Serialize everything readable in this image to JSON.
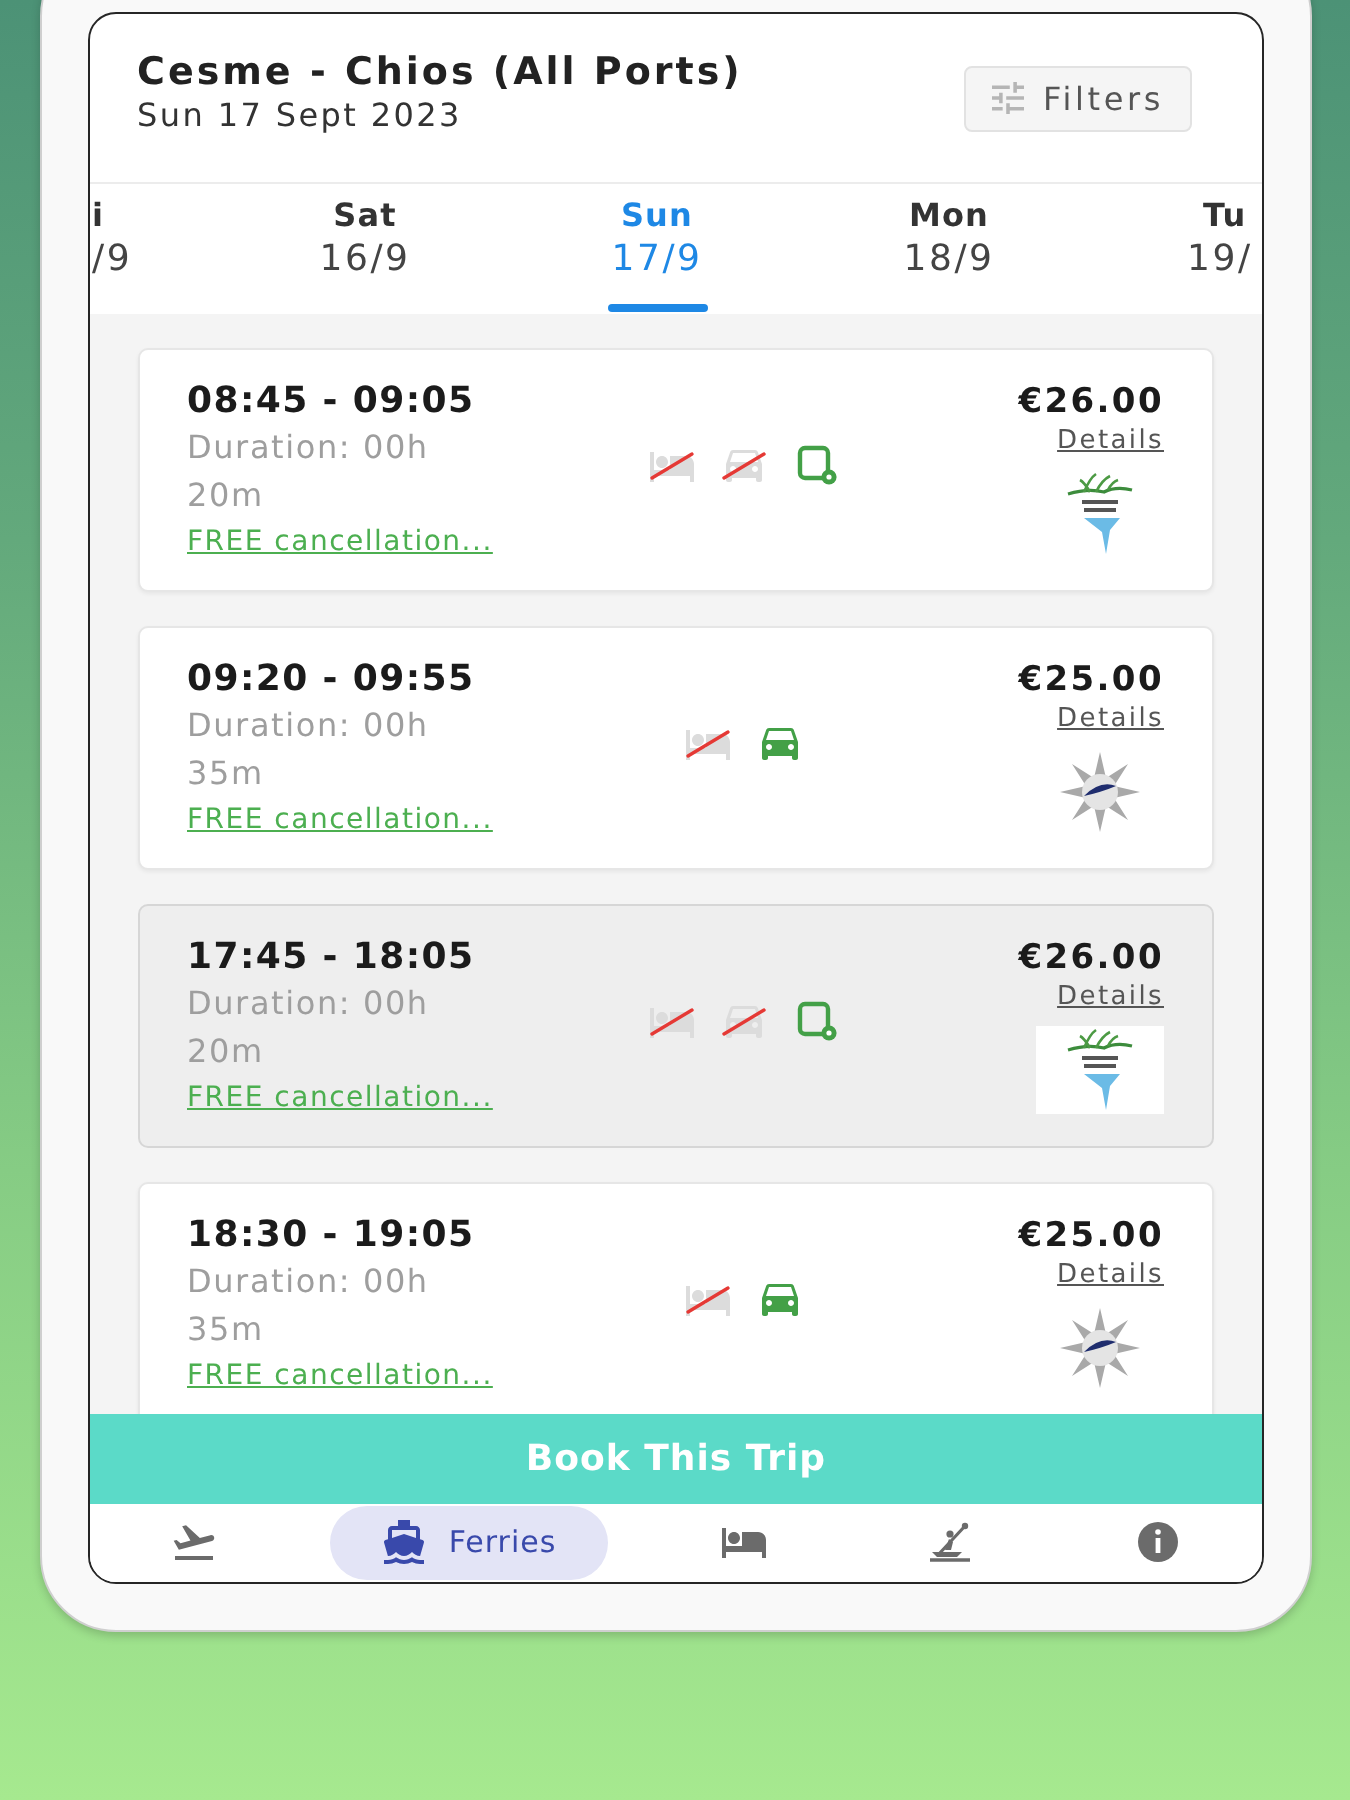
{
  "header": {
    "title": "Cesme - Chios (All Ports)",
    "subtitle": "Sun 17 Sept 2023",
    "filters_button": "Filters"
  },
  "date_tabs": [
    {
      "kind": "cut-left",
      "day": "i",
      "date": "/9",
      "selected": false
    },
    {
      "kind": "full",
      "day": "Sat",
      "date": "16/9",
      "selected": false
    },
    {
      "kind": "full",
      "day": "Sun",
      "date": "17/9",
      "selected": true
    },
    {
      "kind": "full",
      "day": "Mon",
      "date": "18/9",
      "selected": false
    },
    {
      "kind": "cut-right",
      "day": "Tu",
      "date": "19/",
      "selected": false
    }
  ],
  "results": [
    {
      "times": "08:45 - 09:05",
      "duration": "Duration: 00h 20m",
      "cancellation": "FREE cancellation...",
      "price": "€26.00",
      "details": "Details",
      "logo": {
        "kind": "leaf"
      },
      "selected": false,
      "amenities": [
        {
          "kind": "bed",
          "available": false
        },
        {
          "kind": "car",
          "available": false
        },
        {
          "kind": "eticket",
          "available": true
        }
      ]
    },
    {
      "times": "09:20 - 09:55",
      "duration": "Duration: 00h 35m",
      "cancellation": "FREE cancellation...",
      "price": "€25.00",
      "details": "Details",
      "logo": {
        "kind": "compass"
      },
      "selected": false,
      "amenities": [
        {
          "kind": "bed",
          "available": false
        },
        {
          "kind": "car",
          "available": true
        }
      ]
    },
    {
      "times": "17:45 - 18:05",
      "duration": "Duration: 00h 20m",
      "cancellation": "FREE cancellation...",
      "price": "€26.00",
      "details": "Details",
      "logo": {
        "kind": "leaf"
      },
      "selected": true,
      "amenities": [
        {
          "kind": "bed",
          "available": false
        },
        {
          "kind": "car",
          "available": false
        },
        {
          "kind": "eticket",
          "available": true
        }
      ]
    },
    {
      "times": "18:30 - 19:05",
      "duration": "Duration: 00h 35m",
      "cancellation": "FREE cancellation...",
      "price": "€25.00",
      "details": "Details",
      "logo": {
        "kind": "compass"
      },
      "selected": false,
      "amenities": [
        {
          "kind": "bed",
          "available": false
        },
        {
          "kind": "car",
          "available": true
        }
      ]
    }
  ],
  "book_button": "Book This Trip",
  "bottom_nav": [
    {
      "kind": "flights",
      "selected": false
    },
    {
      "kind": "ferries",
      "label": "Ferries",
      "selected": true
    },
    {
      "kind": "hotels",
      "selected": false
    },
    {
      "kind": "activities",
      "selected": false
    },
    {
      "kind": "info",
      "selected": false
    }
  ]
}
